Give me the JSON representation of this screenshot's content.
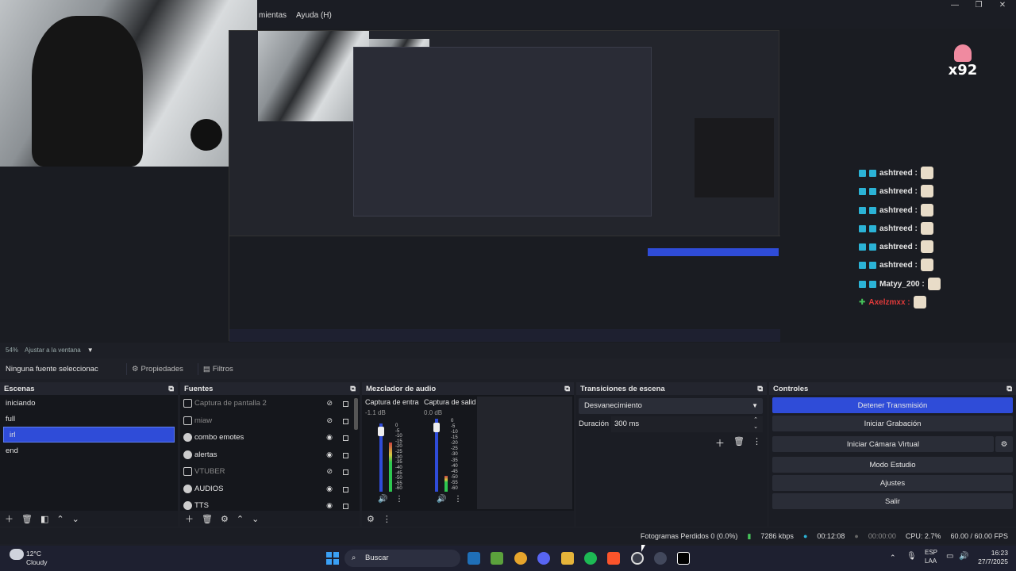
{
  "menu": {
    "items": [
      "mientas",
      "Ayuda (H)"
    ]
  },
  "window_controls": {
    "minimize": "—",
    "maximize": "❐",
    "close": "✕"
  },
  "preview": {
    "logo_text": "x92",
    "chat": [
      {
        "user": "ashtreed :",
        "color": "#ffffff"
      },
      {
        "user": "ashtreed :",
        "color": "#ffffff"
      },
      {
        "user": "ashtreed :",
        "color": "#ffffff"
      },
      {
        "user": "ashtreed :",
        "color": "#ffffff"
      },
      {
        "user": "ashtreed :",
        "color": "#ffffff"
      },
      {
        "user": "ashtreed :",
        "color": "#ffffff"
      },
      {
        "user": "Matyy_200 :",
        "color": "#ffffff"
      },
      {
        "user": "Axelzmxx :",
        "color": "#e03a3a"
      }
    ]
  },
  "scale": {
    "percent": "54%",
    "fit": "Ajustar a la ventana"
  },
  "source_bar": {
    "selection": "Ninguna fuente seleccionac",
    "properties": "Propiedades",
    "filters": "Filtros"
  },
  "scenes": {
    "title": "Escenas",
    "items": [
      "iniciando",
      "full",
      "irl",
      "end"
    ],
    "selected": "irl"
  },
  "sources": {
    "title": "Fuentes",
    "items": [
      {
        "name": "Captura de pantalla 2",
        "visible": false
      },
      {
        "name": "miaw",
        "visible": false
      },
      {
        "name": "combo emotes",
        "visible": true
      },
      {
        "name": "alertas",
        "visible": true
      },
      {
        "name": "VTUBER",
        "visible": false
      },
      {
        "name": "AUDIOS",
        "visible": true
      },
      {
        "name": "TTS",
        "visible": true
      }
    ]
  },
  "mixer": {
    "title": "Mezclador de audio",
    "channels": [
      {
        "name": "Captura de entra",
        "db": "-1.1 dB",
        "level": 0.72
      },
      {
        "name": "Captura de salid",
        "db": "0.0 dB",
        "level": 0.22
      }
    ],
    "ticks": [
      "0",
      "-5",
      "-10",
      "-15",
      "-20",
      "-25",
      "-30",
      "-35",
      "-40",
      "-45",
      "-50",
      "-55",
      "-60"
    ]
  },
  "transitions": {
    "title": "Transiciones de escena",
    "type": "Desvanecimiento",
    "duration_label": "Duración",
    "duration_value": "300 ms"
  },
  "controls": {
    "title": "Controles",
    "buttons": [
      "Detener Transmisión",
      "Iniciar Grabación",
      "Iniciar Cámara Virtual",
      "Modo Estudio",
      "Ajustes",
      "Salir"
    ]
  },
  "status": {
    "dropped": "Fotogramas Perdidos 0 (0.0%)",
    "bitrate": "7286 kbps",
    "stream_time": "00:12:08",
    "rec_time": "00:00:00",
    "cpu": "CPU: 2.7%",
    "fps": "60.00 / 60.00 FPS"
  },
  "taskbar": {
    "weather_temp": "12°C",
    "weather_desc": "Cloudy",
    "search": "Buscar",
    "lang1": "ESP",
    "lang2": "LAA",
    "time": "16:23",
    "date": "27/7/2025"
  }
}
